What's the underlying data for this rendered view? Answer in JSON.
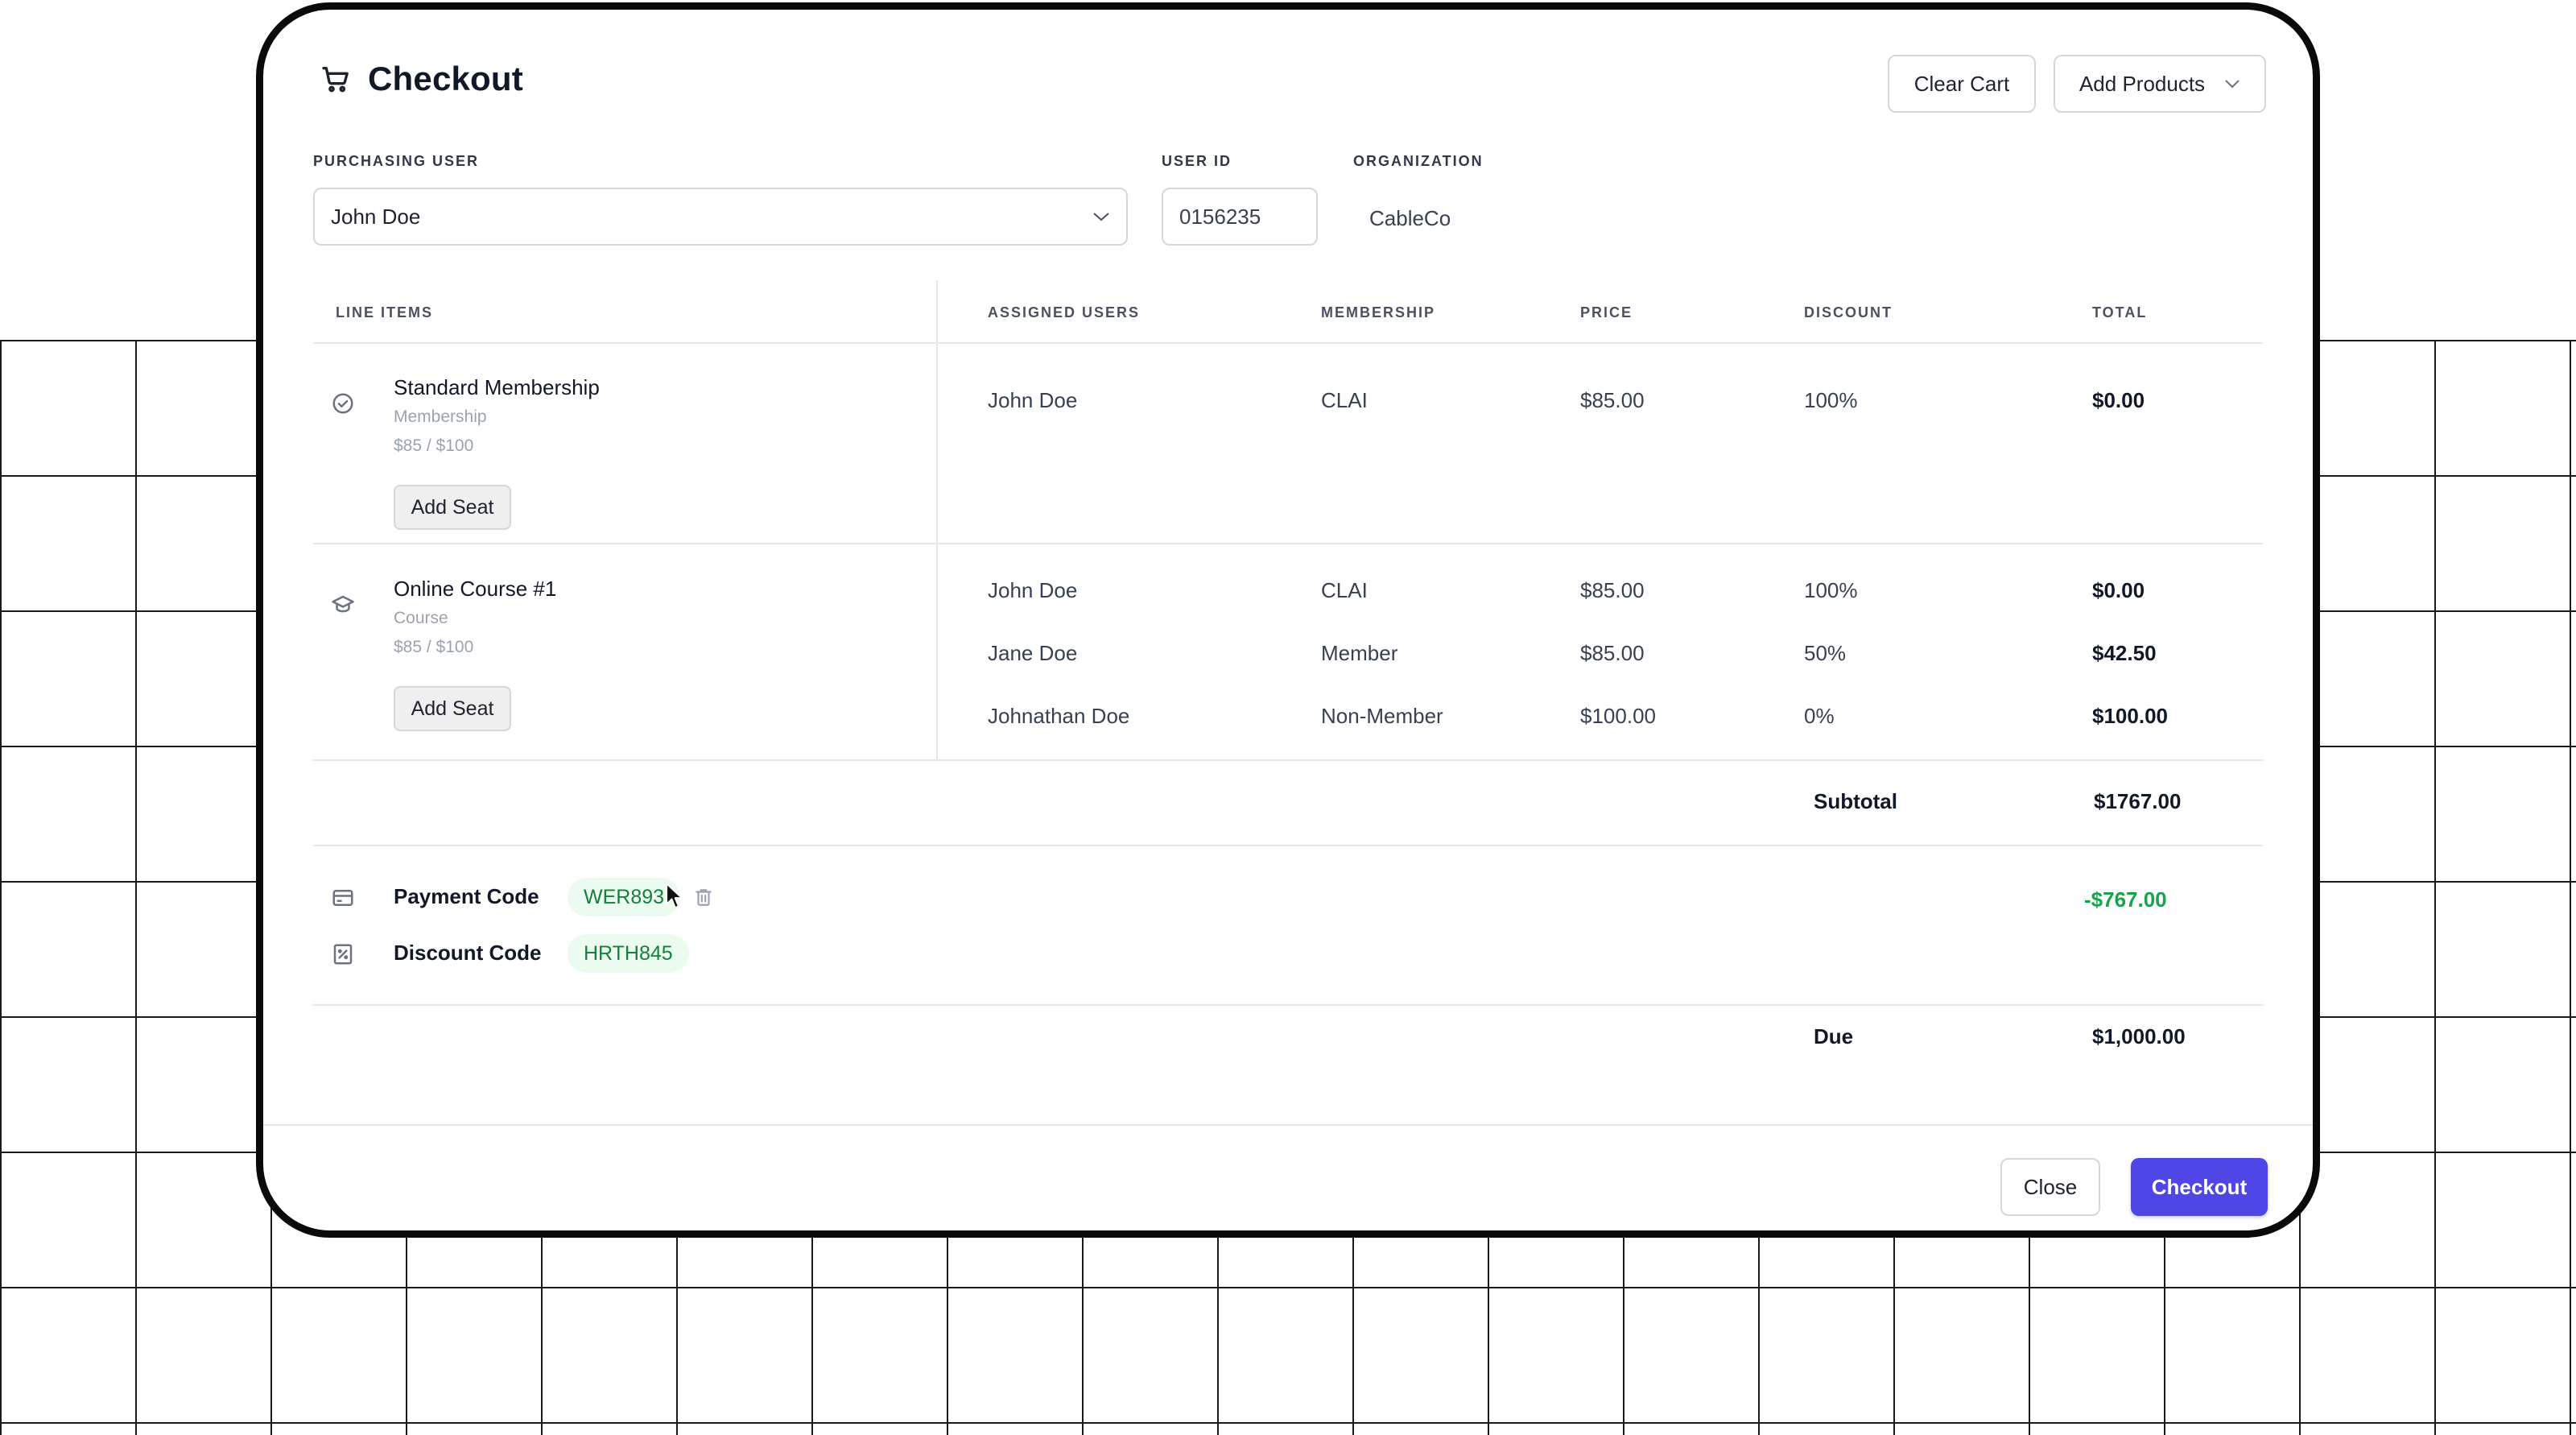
{
  "colors": {
    "accent": "#4f46e5",
    "positive": "#16a34a",
    "chip_bg": "#ecfbef",
    "chip_text": "#15803d"
  },
  "header": {
    "title": "Checkout",
    "icon": "cart-icon",
    "clear_cart": "Clear Cart",
    "add_products": "Add Products"
  },
  "fields": {
    "purchasing_user_label": "PURCHASING USER",
    "purchasing_user_value": "John Doe",
    "user_id_label": "USER ID",
    "user_id_value": "0156235",
    "organization_label": "ORGANIZATION",
    "organization_value": "CableCo"
  },
  "columns": {
    "line_items": "LINE ITEMS",
    "assigned_users": "ASSIGNED USERS",
    "membership": "MEMBERSHIP",
    "price": "PRICE",
    "discount": "DISCOUNT",
    "total": "TOTAL"
  },
  "items": [
    {
      "name": "Standard Membership",
      "type": "Membership",
      "price_range": "$85 / $100",
      "icon": "check-circle-icon",
      "add_seat": "Add Seat",
      "rows": [
        {
          "user": "John Doe",
          "membership": "CLAI",
          "price": "$85.00",
          "discount": "100%",
          "total": "$0.00"
        }
      ]
    },
    {
      "name": "Online Course #1",
      "type": "Course",
      "price_range": "$85 / $100",
      "icon": "graduation-cap-icon",
      "add_seat": "Add Seat",
      "rows": [
        {
          "user": "John Doe",
          "membership": "CLAI",
          "price": "$85.00",
          "discount": "100%",
          "total": "$0.00"
        },
        {
          "user": "Jane Doe",
          "membership": "Member",
          "price": "$85.00",
          "discount": "50%",
          "total": "$42.50"
        },
        {
          "user": "Johnathan Doe",
          "membership": "Non-Member",
          "price": "$100.00",
          "discount": "0%",
          "total": "$100.00"
        }
      ]
    }
  ],
  "summary": {
    "subtotal_label": "Subtotal",
    "subtotal_value": "$1767.00",
    "payment_code_label": "Payment Code",
    "payment_code_value": "WER893",
    "discount_code_label": "Discount Code",
    "discount_code_value": "HRTH845",
    "codes_amount": "-$767.00",
    "due_label": "Due",
    "due_value": "$1,000.00"
  },
  "footer": {
    "close": "Close",
    "checkout": "Checkout"
  }
}
